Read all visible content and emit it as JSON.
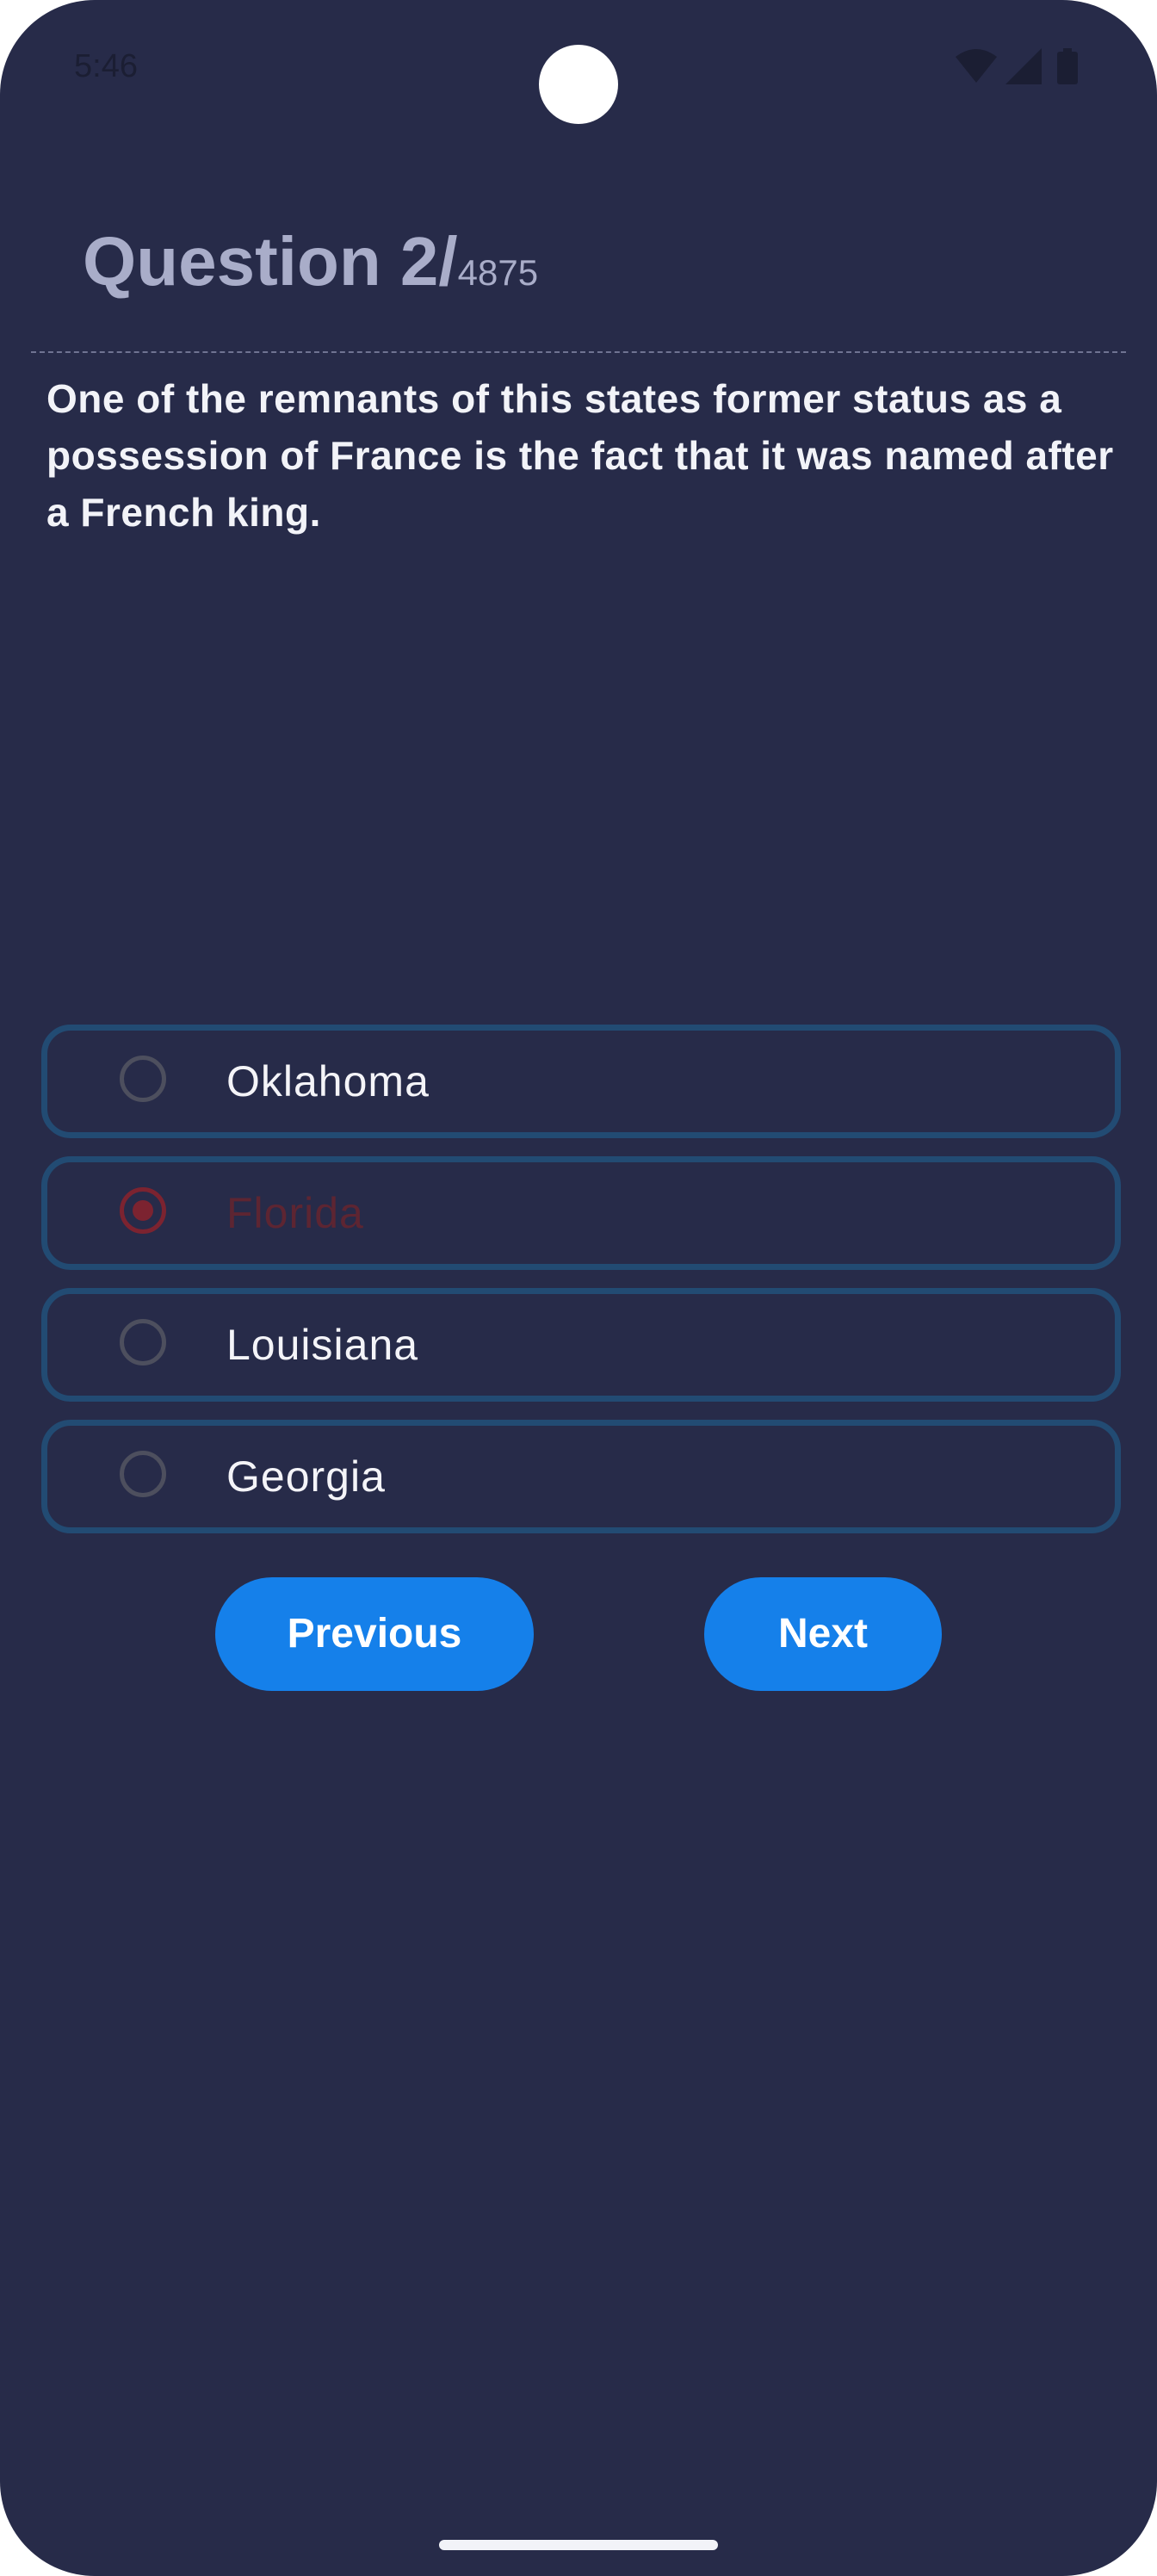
{
  "status_bar": {
    "time": "5:46",
    "icons": [
      "wifi-icon",
      "signal-icon",
      "battery-icon"
    ]
  },
  "header": {
    "question_prefix": "Question 2/",
    "total": "4875"
  },
  "question": {
    "text": "One of the remnants of this states former status as a possession of France is the fact that it was named after a French king."
  },
  "options": [
    {
      "label": "Oklahoma",
      "selected": false
    },
    {
      "label": "Florida",
      "selected": true
    },
    {
      "label": "Louisiana",
      "selected": false
    },
    {
      "label": "Georgia",
      "selected": false
    }
  ],
  "buttons": {
    "previous_label": "Previous",
    "next_label": "Next"
  },
  "colors": {
    "background": "#272b49",
    "accent": "#1580ea",
    "option_border": "#224b73",
    "selected": "#7c2330"
  }
}
